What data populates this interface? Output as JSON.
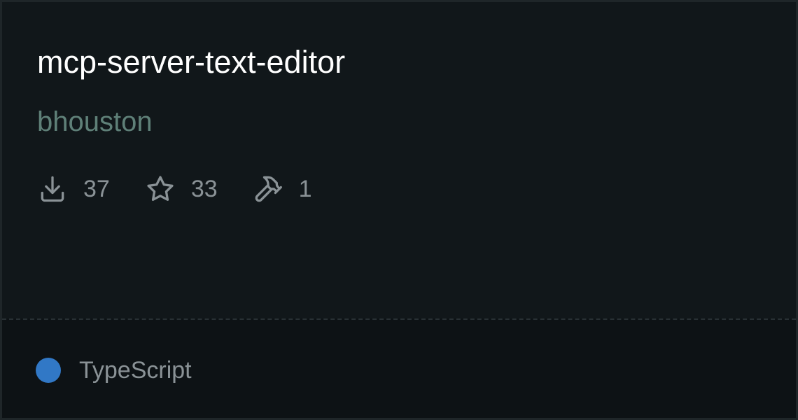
{
  "repo": {
    "name": "mcp-server-text-editor",
    "owner": "bhouston"
  },
  "stats": {
    "downloads": {
      "icon": "download-icon",
      "value": "37"
    },
    "stars": {
      "icon": "star-icon",
      "value": "33"
    },
    "tools": {
      "icon": "hammer-icon",
      "value": "1"
    }
  },
  "footer": {
    "language": "TypeScript",
    "language_color": "#3178c6"
  },
  "colors": {
    "background": "#11171a",
    "title": "#ffffff",
    "owner": "#5f8078",
    "muted": "#8a9296"
  }
}
